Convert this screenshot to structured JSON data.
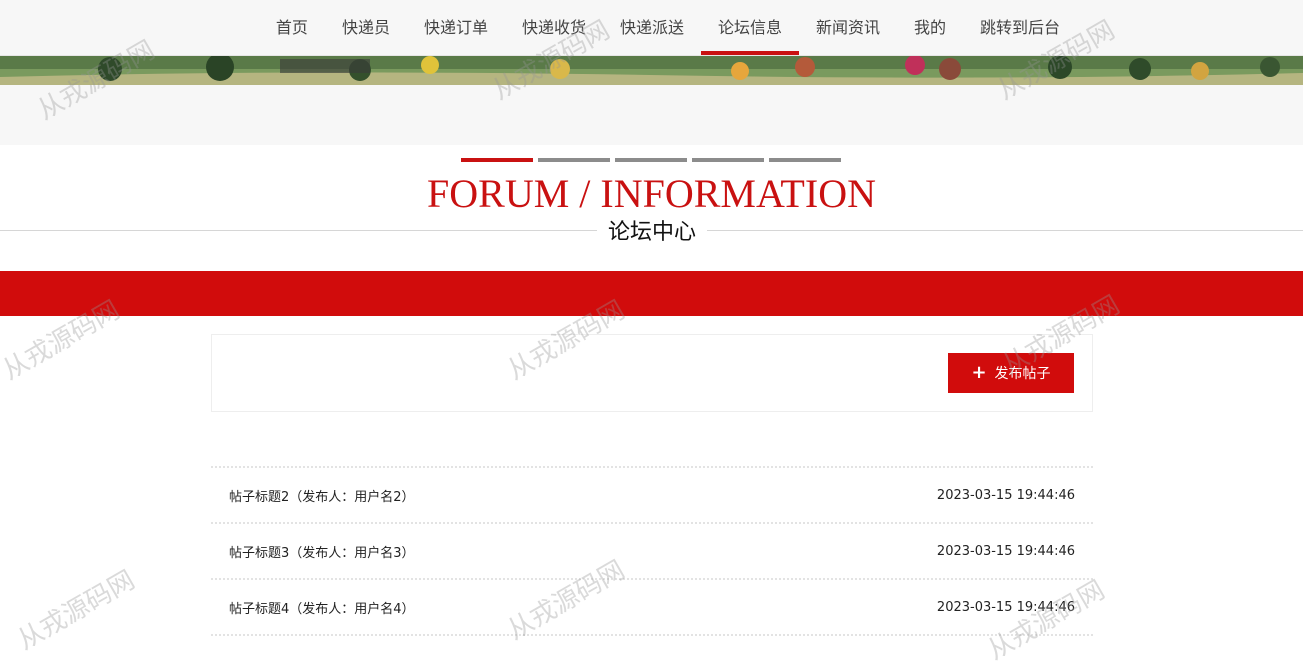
{
  "nav": {
    "items": [
      {
        "label": "首页"
      },
      {
        "label": "快递员"
      },
      {
        "label": "快递订单"
      },
      {
        "label": "快递收货"
      },
      {
        "label": "快递派送"
      },
      {
        "label": "论坛信息",
        "active": true
      },
      {
        "label": "新闻资讯"
      },
      {
        "label": "我的"
      },
      {
        "label": "跳转到后台"
      }
    ]
  },
  "heading": {
    "en": "FORUM / INFORMATION",
    "cn": "论坛中心"
  },
  "toolbar": {
    "post_button_label": "发布帖子"
  },
  "posts": [
    {
      "title": "帖子标题2（发布人：用户名2）",
      "time": "2023-03-15 19:44:46"
    },
    {
      "title": "帖子标题3（发布人：用户名3）",
      "time": "2023-03-15 19:44:46"
    },
    {
      "title": "帖子标题4（发布人：用户名4）",
      "time": "2023-03-15 19:44:46"
    }
  ],
  "watermark": "从戎源码网",
  "colors": {
    "accent": "#d10c0c",
    "nav_bg": "#f7f7f7"
  }
}
